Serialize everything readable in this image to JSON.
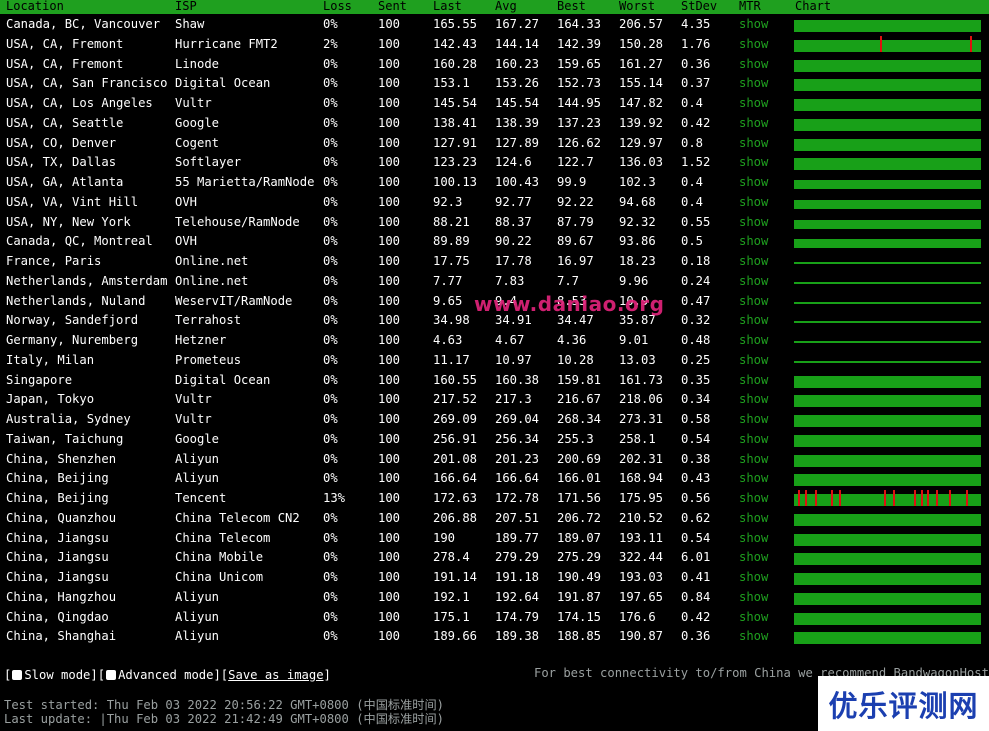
{
  "headers": {
    "location": "Location",
    "isp": "ISP",
    "loss": "Loss",
    "sent": "Sent",
    "last": "Last",
    "avg": "Avg",
    "best": "Best",
    "worst": "Worst",
    "stdev": "StDev",
    "mtr": "MTR",
    "chart": "Chart"
  },
  "rows": [
    {
      "location": "Canada, BC, Vancouver",
      "isp": "Shaw",
      "loss": "0%",
      "sent": "100",
      "last": "165.55",
      "avg": "167.27",
      "best": "164.33",
      "worst": "206.57",
      "stdev": "4.35",
      "mtr": "show",
      "bar": "full",
      "spikes": []
    },
    {
      "location": "USA, CA, Fremont",
      "isp": "Hurricane FMT2",
      "loss": "2%",
      "sent": "100",
      "last": "142.43",
      "avg": "144.14",
      "best": "142.39",
      "worst": "150.28",
      "stdev": "1.76",
      "mtr": "show",
      "bar": "full",
      "spikes": [
        0.46,
        0.94
      ]
    },
    {
      "location": "USA, CA, Fremont",
      "isp": "Linode",
      "loss": "0%",
      "sent": "100",
      "last": "160.28",
      "avg": "160.23",
      "best": "159.65",
      "worst": "161.27",
      "stdev": "0.36",
      "mtr": "show",
      "bar": "full",
      "spikes": []
    },
    {
      "location": "USA, CA, San Francisco",
      "isp": "Digital Ocean",
      "loss": "0%",
      "sent": "100",
      "last": "153.1",
      "avg": "153.26",
      "best": "152.73",
      "worst": "155.14",
      "stdev": "0.37",
      "mtr": "show",
      "bar": "full",
      "spikes": []
    },
    {
      "location": "USA, CA, Los Angeles",
      "isp": "Vultr",
      "loss": "0%",
      "sent": "100",
      "last": "145.54",
      "avg": "145.54",
      "best": "144.95",
      "worst": "147.82",
      "stdev": "0.4",
      "mtr": "show",
      "bar": "full",
      "spikes": []
    },
    {
      "location": "USA, CA, Seattle",
      "isp": "Google",
      "loss": "0%",
      "sent": "100",
      "last": "138.41",
      "avg": "138.39",
      "best": "137.23",
      "worst": "139.92",
      "stdev": "0.42",
      "mtr": "show",
      "bar": "full",
      "spikes": []
    },
    {
      "location": "USA, CO, Denver",
      "isp": "Cogent",
      "loss": "0%",
      "sent": "100",
      "last": "127.91",
      "avg": "127.89",
      "best": "126.62",
      "worst": "129.97",
      "stdev": "0.8",
      "mtr": "show",
      "bar": "full",
      "spikes": []
    },
    {
      "location": "USA, TX, Dallas",
      "isp": "Softlayer",
      "loss": "0%",
      "sent": "100",
      "last": "123.23",
      "avg": "124.6",
      "best": "122.7",
      "worst": "136.03",
      "stdev": "1.52",
      "mtr": "show",
      "bar": "full",
      "spikes": []
    },
    {
      "location": "USA, GA, Atlanta",
      "isp": "55 Marietta/RamNode",
      "loss": "0%",
      "sent": "100",
      "last": "100.13",
      "avg": "100.43",
      "best": "99.9",
      "worst": "102.3",
      "stdev": "0.4",
      "mtr": "show",
      "bar": "mid",
      "spikes": []
    },
    {
      "location": "USA, VA, Vint Hill",
      "isp": "OVH",
      "loss": "0%",
      "sent": "100",
      "last": "92.3",
      "avg": "92.77",
      "best": "92.22",
      "worst": "94.68",
      "stdev": "0.4",
      "mtr": "show",
      "bar": "mid",
      "spikes": []
    },
    {
      "location": "USA, NY, New York",
      "isp": "Telehouse/RamNode",
      "loss": "0%",
      "sent": "100",
      "last": "88.21",
      "avg": "88.37",
      "best": "87.79",
      "worst": "92.32",
      "stdev": "0.55",
      "mtr": "show",
      "bar": "mid",
      "spikes": []
    },
    {
      "location": "Canada, QC, Montreal",
      "isp": "OVH",
      "loss": "0%",
      "sent": "100",
      "last": "89.89",
      "avg": "90.22",
      "best": "89.67",
      "worst": "93.86",
      "stdev": "0.5",
      "mtr": "show",
      "bar": "mid",
      "spikes": []
    },
    {
      "location": "France, Paris",
      "isp": "Online.net",
      "loss": "0%",
      "sent": "100",
      "last": "17.75",
      "avg": "17.78",
      "best": "16.97",
      "worst": "18.23",
      "stdev": "0.18",
      "mtr": "show",
      "bar": "thin",
      "spikes": []
    },
    {
      "location": "Netherlands, Amsterdam",
      "isp": "Online.net",
      "loss": "0%",
      "sent": "100",
      "last": "7.77",
      "avg": "7.83",
      "best": "7.7",
      "worst": "9.96",
      "stdev": "0.24",
      "mtr": "show",
      "bar": "thin",
      "spikes": []
    },
    {
      "location": "Netherlands, Nuland",
      "isp": "WeservIT/RamNode",
      "loss": "0%",
      "sent": "100",
      "last": "9.65",
      "avg": "9.4",
      "best": "8.53",
      "worst": "10.9",
      "stdev": "0.47",
      "mtr": "show",
      "bar": "thin",
      "spikes": []
    },
    {
      "location": "Norway, Sandefjord",
      "isp": "Terrahost",
      "loss": "0%",
      "sent": "100",
      "last": "34.98",
      "avg": "34.91",
      "best": "34.47",
      "worst": "35.87",
      "stdev": "0.32",
      "mtr": "show",
      "bar": "thin",
      "spikes": []
    },
    {
      "location": "Germany, Nuremberg",
      "isp": "Hetzner",
      "loss": "0%",
      "sent": "100",
      "last": "4.63",
      "avg": "4.67",
      "best": "4.36",
      "worst": "9.01",
      "stdev": "0.48",
      "mtr": "show",
      "bar": "thin",
      "spikes": []
    },
    {
      "location": "Italy, Milan",
      "isp": "Prometeus",
      "loss": "0%",
      "sent": "100",
      "last": "11.17",
      "avg": "10.97",
      "best": "10.28",
      "worst": "13.03",
      "stdev": "0.25",
      "mtr": "show",
      "bar": "thin",
      "spikes": []
    },
    {
      "location": "Singapore",
      "isp": "Digital Ocean",
      "loss": "0%",
      "sent": "100",
      "last": "160.55",
      "avg": "160.38",
      "best": "159.81",
      "worst": "161.73",
      "stdev": "0.35",
      "mtr": "show",
      "bar": "full",
      "spikes": []
    },
    {
      "location": "Japan, Tokyo",
      "isp": "Vultr",
      "loss": "0%",
      "sent": "100",
      "last": "217.52",
      "avg": "217.3",
      "best": "216.67",
      "worst": "218.06",
      "stdev": "0.34",
      "mtr": "show",
      "bar": "full",
      "spikes": []
    },
    {
      "location": "Australia, Sydney",
      "isp": "Vultr",
      "loss": "0%",
      "sent": "100",
      "last": "269.09",
      "avg": "269.04",
      "best": "268.34",
      "worst": "273.31",
      "stdev": "0.58",
      "mtr": "show",
      "bar": "full",
      "spikes": []
    },
    {
      "location": "Taiwan, Taichung",
      "isp": "Google",
      "loss": "0%",
      "sent": "100",
      "last": "256.91",
      "avg": "256.34",
      "best": "255.3",
      "worst": "258.1",
      "stdev": "0.54",
      "mtr": "show",
      "bar": "full",
      "spikes": []
    },
    {
      "location": "China, Shenzhen",
      "isp": "Aliyun",
      "loss": "0%",
      "sent": "100",
      "last": "201.08",
      "avg": "201.23",
      "best": "200.69",
      "worst": "202.31",
      "stdev": "0.38",
      "mtr": "show",
      "bar": "full",
      "spikes": []
    },
    {
      "location": "China, Beijing",
      "isp": "Aliyun",
      "loss": "0%",
      "sent": "100",
      "last": "166.64",
      "avg": "166.64",
      "best": "166.01",
      "worst": "168.94",
      "stdev": "0.43",
      "mtr": "show",
      "bar": "full",
      "spikes": []
    },
    {
      "location": "China, Beijing",
      "isp": "Tencent",
      "loss": "13%",
      "sent": "100",
      "last": "172.63",
      "avg": "172.78",
      "best": "171.56",
      "worst": "175.95",
      "stdev": "0.56",
      "mtr": "show",
      "bar": "full",
      "spikes": [
        0.02,
        0.06,
        0.11,
        0.2,
        0.24,
        0.48,
        0.53,
        0.64,
        0.68,
        0.71,
        0.76,
        0.83,
        0.92
      ]
    },
    {
      "location": "China, Quanzhou",
      "isp": "China Telecom CN2",
      "loss": "0%",
      "sent": "100",
      "last": "206.88",
      "avg": "207.51",
      "best": "206.72",
      "worst": "210.52",
      "stdev": "0.62",
      "mtr": "show",
      "bar": "full",
      "spikes": []
    },
    {
      "location": "China, Jiangsu",
      "isp": "China Telecom",
      "loss": "0%",
      "sent": "100",
      "last": "190",
      "avg": "189.77",
      "best": "189.07",
      "worst": "193.11",
      "stdev": "0.54",
      "mtr": "show",
      "bar": "full",
      "spikes": []
    },
    {
      "location": "China, Jiangsu",
      "isp": "China Mobile",
      "loss": "0%",
      "sent": "100",
      "last": "278.4",
      "avg": "279.29",
      "best": "275.29",
      "worst": "322.44",
      "stdev": "6.01",
      "mtr": "show",
      "bar": "full",
      "spikes": []
    },
    {
      "location": "China, Jiangsu",
      "isp": "China Unicom",
      "loss": "0%",
      "sent": "100",
      "last": "191.14",
      "avg": "191.18",
      "best": "190.49",
      "worst": "193.03",
      "stdev": "0.41",
      "mtr": "show",
      "bar": "full",
      "spikes": []
    },
    {
      "location": "China, Hangzhou",
      "isp": "Aliyun",
      "loss": "0%",
      "sent": "100",
      "last": "192.1",
      "avg": "192.64",
      "best": "191.87",
      "worst": "197.65",
      "stdev": "0.84",
      "mtr": "show",
      "bar": "full",
      "spikes": []
    },
    {
      "location": "China, Qingdao",
      "isp": "Aliyun",
      "loss": "0%",
      "sent": "100",
      "last": "175.1",
      "avg": "174.79",
      "best": "174.15",
      "worst": "176.6",
      "stdev": "0.42",
      "mtr": "show",
      "bar": "full",
      "spikes": []
    },
    {
      "location": "China, Shanghai",
      "isp": "Aliyun",
      "loss": "0%",
      "sent": "100",
      "last": "189.66",
      "avg": "189.38",
      "best": "188.85",
      "worst": "190.87",
      "stdev": "0.36",
      "mtr": "show",
      "bar": "full",
      "spikes": []
    }
  ],
  "controls": {
    "slow_mode": "Slow mode",
    "advanced_mode": "Advanced mode",
    "save_as_image": "Save as image"
  },
  "recommendation": "For best connectivity to/from China we recommend BandwagonHost.",
  "test_started": "Test started: Thu Feb 03 2022 20:56:22 GMT+0800 (中国标准时间)",
  "last_update": "Last update: |Thu Feb 03 2022 21:42:49 GMT+0800 (中国标准时间)",
  "watermark": "www.daniao.org",
  "logo_text": "优乐评测网"
}
